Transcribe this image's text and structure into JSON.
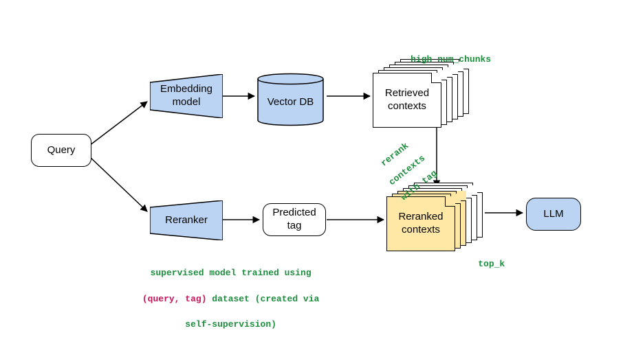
{
  "nodes": {
    "query": "Query",
    "embedding_model": "Embedding\nmodel",
    "vector_db": "Vector DB",
    "retrieved_contexts": "Retrieved\ncontexts",
    "reranker": "Reranker",
    "predicted_tag": "Predicted\ntag",
    "reranked_contexts": "Reranked\ncontexts",
    "llm": "LLM"
  },
  "annotations": {
    "high_num_chunks": "high num_chunks",
    "rerank_line1": "rerank",
    "rerank_line2": "contexts",
    "rerank_line3": "with tag",
    "top_k": "top_k",
    "supervision_line1_a": "supervised model trained using",
    "supervision_line2_a": "(query, tag)",
    "supervision_line2_b": " dataset (created via",
    "supervision_line3": "self-supervision)"
  },
  "colors": {
    "node_fill_blue": "#bcd4f3",
    "doc_yellow": "#ffe8a5",
    "annotation_green": "#1e8e3e",
    "annotation_magenta": "#c2185b"
  }
}
